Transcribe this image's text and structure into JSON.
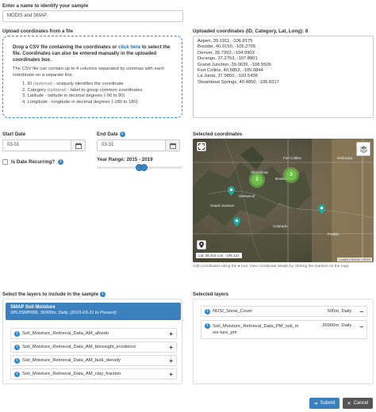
{
  "name_section": {
    "label": "Enter a name to identify your sample",
    "value": "MODIS and SMAP"
  },
  "upload": {
    "label": "Upload coordinates from a file",
    "drop_text_1": "Drop a CSV file containing the coordinates or ",
    "drop_link": "click here",
    "drop_text_2": " to select the file. Coordinates can also be entered manually in the uploaded coordinates box.",
    "columns_intro": "The CSV file can contain up to 4 columns separated by commas with each coordinate on a separate line.",
    "columns": [
      {
        "num": "1. ",
        "name": "ID ",
        "note": "(optional)",
        "desc": " - uniquely identifies the coordinate"
      },
      {
        "num": "2. ",
        "name": "Category ",
        "note": "(optional)",
        "desc": " - label to group common coordinates"
      },
      {
        "num": "3. ",
        "name": "Latitude",
        "note": "",
        "desc": " - latitude in decimal degrees (-90 to 90)"
      },
      {
        "num": "4. ",
        "name": "Longitude",
        "note": "",
        "desc": " - longitude in decimal degrees (-180 to 180)"
      }
    ]
  },
  "uploaded": {
    "label": "Uploaded coordinates (ID, Category, Lat, Long): 8",
    "lines": [
      "Aspen, 39.1911, -106.8175",
      "Boulder, 40.0150, -105.2705",
      "Denver, 39.7392, -104.9903",
      "Durango, 37.2753, -107.8801",
      "Grand Junction, 39.0639, -108.5506",
      "Fort Collins, 40.5853, -105.0844",
      "La Junta, 37.9850, -103.5438",
      "Steamboat Springs, 40.4850, -106.8317"
    ]
  },
  "dates": {
    "start_label": "Start Date",
    "start_value": "03-01",
    "end_label": "End Date",
    "end_value": "03-31",
    "recurring_label": "Is Date Recurring?",
    "year_range_label": "Year Range: 2015 - 2019"
  },
  "map": {
    "label": "Selected coordinates",
    "coords": "Lat: 38.416 Lon: -108.121",
    "attribution": "Leaflet | NASA, USGS",
    "help_text": "Add coordinates using the ",
    "help_text_2": " tool. View coordinate details by clicking the markers on the map.",
    "cluster_a": "2",
    "cluster_b": "3",
    "labels": {
      "steamboat": "Steamboat",
      "fort_collins": "Fort Collins",
      "boulder": "Boulder",
      "glenwood": "Glenwood",
      "junction": "Grand Junction",
      "colorado": "Colorado",
      "pueblo": "Pueblo",
      "nebraska": "Nebraska"
    }
  },
  "layers": {
    "label": "Select the layers to include in the sample",
    "selected_product": "SMAP Soil Moisture",
    "selected_product_desc": "SPL3SMP006, 36000m, Daily, (2015-03-31 to Present)",
    "available": [
      "Soil_Moisture_Retrieval_Data_AM_albedo",
      "Soil_Moisture_Retrieval_Data_AM_boresight_incidence",
      "Soil_Moisture_Retrieval_Data_AM_bulk_density",
      "Soil_Moisture_Retrieval_Data_AM_clay_fraction"
    ]
  },
  "selected_layers": {
    "label": "Selected layers",
    "items": [
      {
        "name": "NDSI_Snow_Cover",
        "res": "500m, Daily"
      },
      {
        "name": "Soil_Moisture_Retrieval_Data_PM_soil_mois-ture_pm",
        "res": "36000m, Daily"
      }
    ]
  },
  "actions": {
    "submit": "Submit",
    "cancel": "Cancel"
  }
}
